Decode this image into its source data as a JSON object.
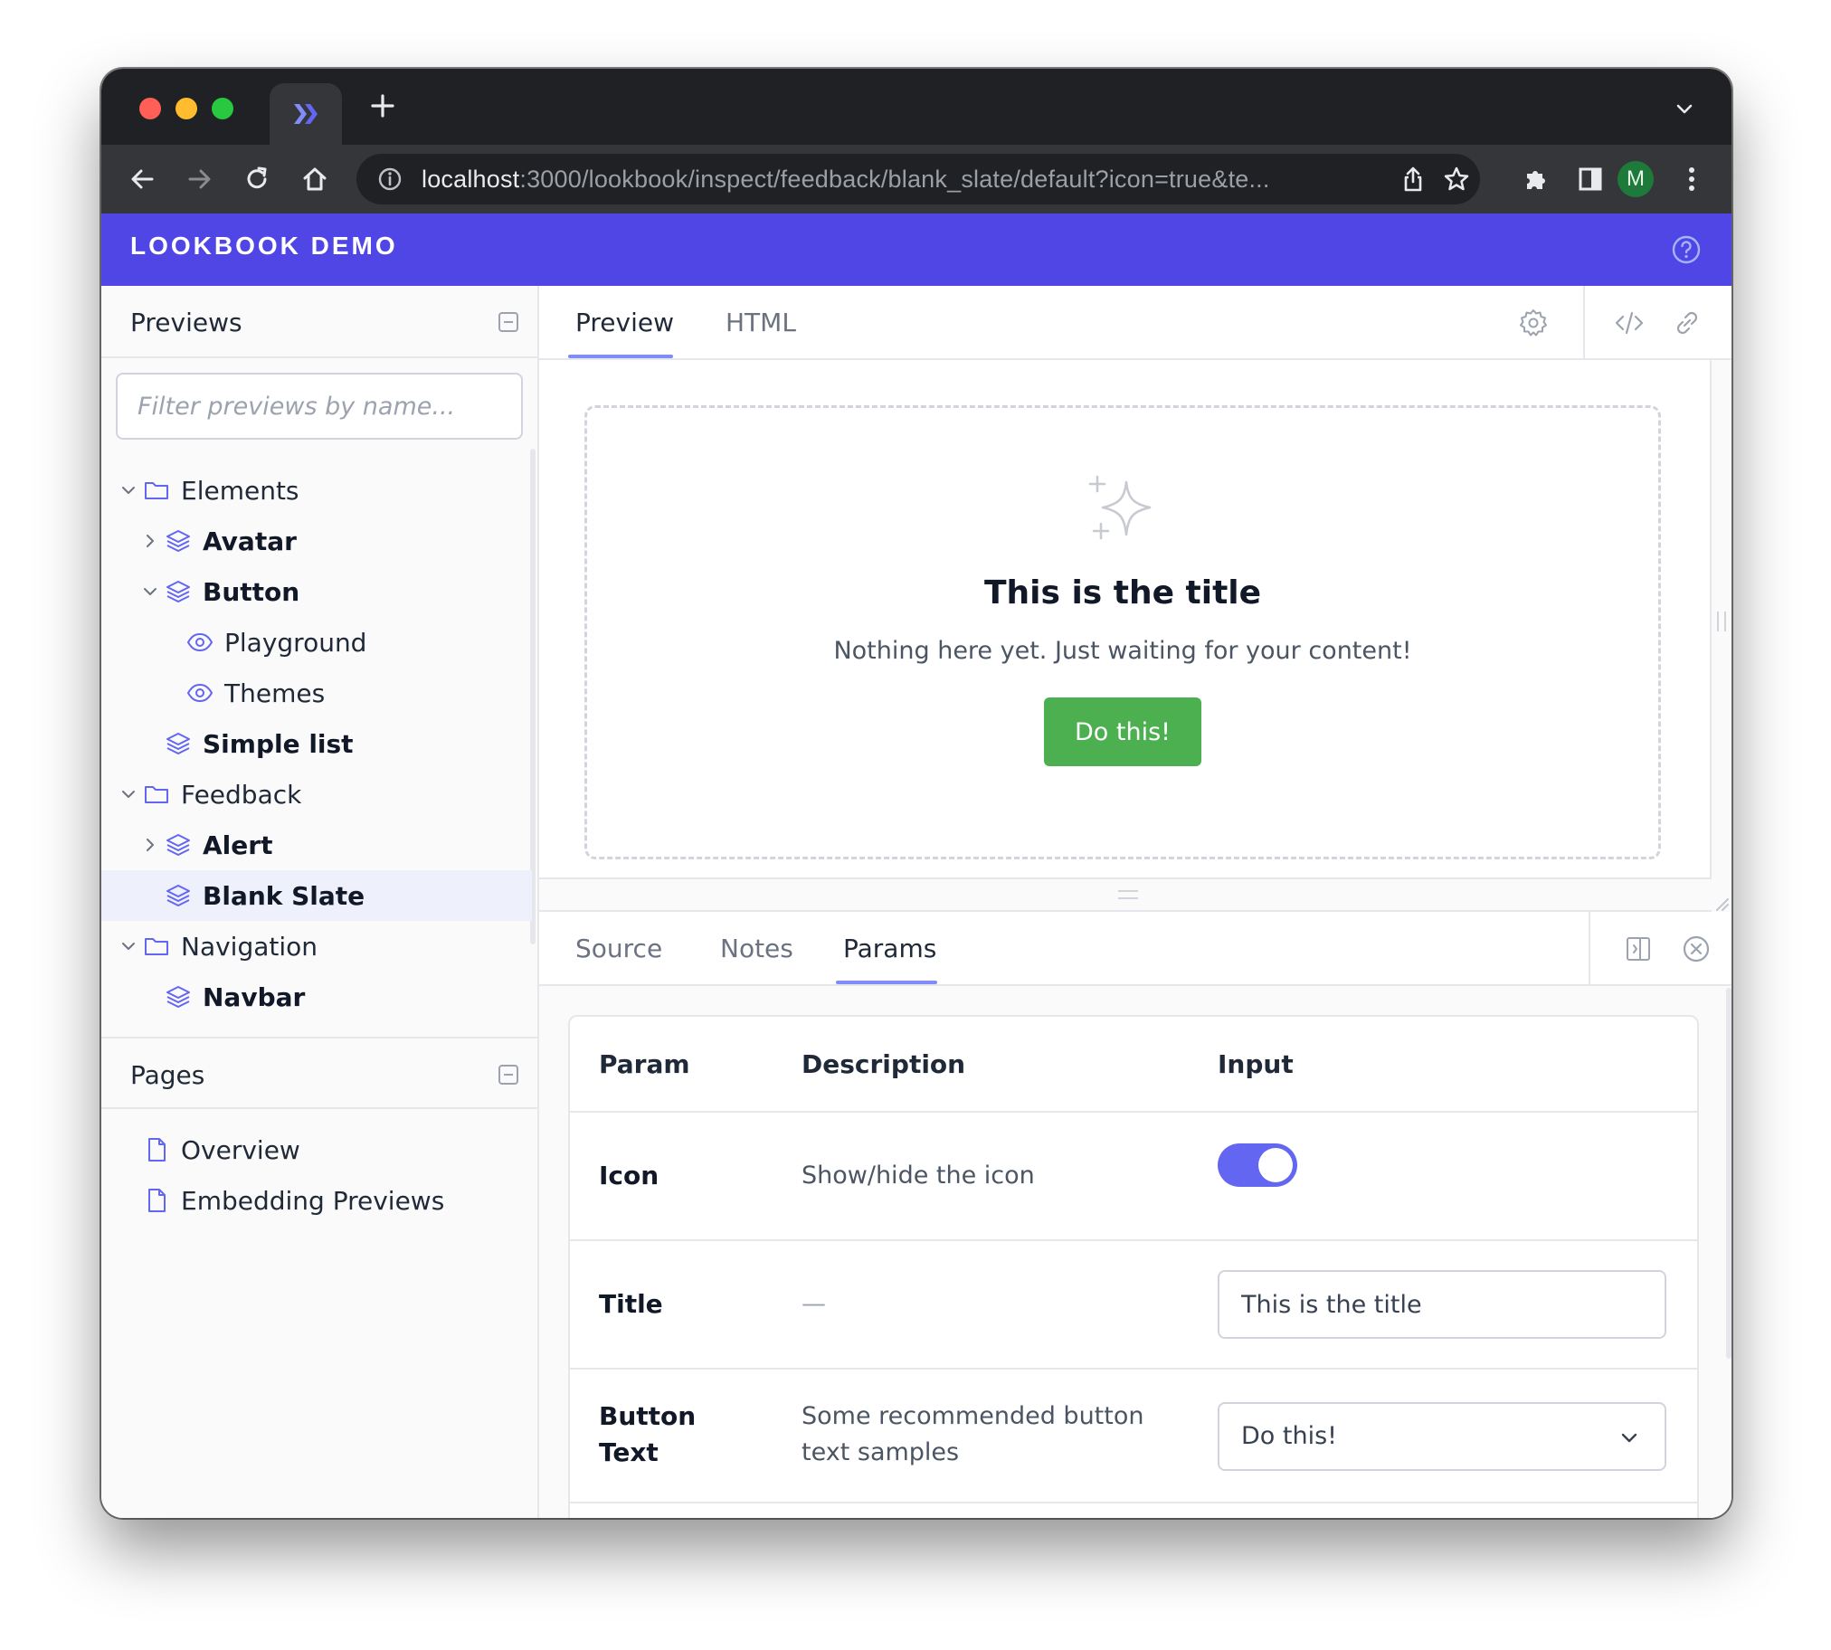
{
  "browser": {
    "url_host": "localhost",
    "url_rest": ":3000/lookbook/inspect/feedback/blank_slate/default?icon=true&te...",
    "profile_initial": "M"
  },
  "app": {
    "brand": "LOOKBOOK DEMO",
    "accent_color": "#4f46e5"
  },
  "sidebar": {
    "previews_title": "Previews",
    "filter_placeholder": "Filter previews by name...",
    "tree": [
      {
        "label": "Elements",
        "icon": "folder-icon"
      },
      {
        "label": "Avatar",
        "icon": "layers-icon"
      },
      {
        "label": "Button",
        "icon": "layers-icon"
      },
      {
        "label": "Playground",
        "icon": "eye-icon"
      },
      {
        "label": "Themes",
        "icon": "eye-icon"
      },
      {
        "label": "Simple list",
        "icon": "layers-icon"
      },
      {
        "label": "Feedback",
        "icon": "folder-icon"
      },
      {
        "label": "Alert",
        "icon": "layers-icon"
      },
      {
        "label": "Blank Slate",
        "icon": "layers-icon",
        "selected": true
      },
      {
        "label": "Navigation",
        "icon": "folder-icon"
      },
      {
        "label": "Navbar",
        "icon": "layers-icon"
      }
    ],
    "pages_title": "Pages",
    "pages": [
      {
        "label": "Overview",
        "icon": "file-icon"
      },
      {
        "label": "Embedding Previews",
        "icon": "file-icon"
      }
    ]
  },
  "main": {
    "tabs": [
      "Preview",
      "HTML"
    ],
    "active_tab": "Preview"
  },
  "preview": {
    "title": "This is the title",
    "description": "Nothing here yet. Just waiting for your content!",
    "button_label": "Do this!",
    "button_color": "#4caf50"
  },
  "inspector": {
    "tabs": [
      "Source",
      "Notes",
      "Params"
    ],
    "active_tab": "Params",
    "columns": [
      "Param",
      "Description",
      "Input"
    ],
    "rows": [
      {
        "name": "Icon",
        "description": "Show/hide the icon",
        "type": "toggle",
        "value": "true"
      },
      {
        "name": "Title",
        "description": "—",
        "type": "text",
        "value": "This is the title"
      },
      {
        "name_line1": "Button",
        "name_line2": "Text",
        "description_line1": "Some recommended button",
        "description_line2": "text samples",
        "type": "select",
        "value": "Do this!"
      }
    ]
  }
}
